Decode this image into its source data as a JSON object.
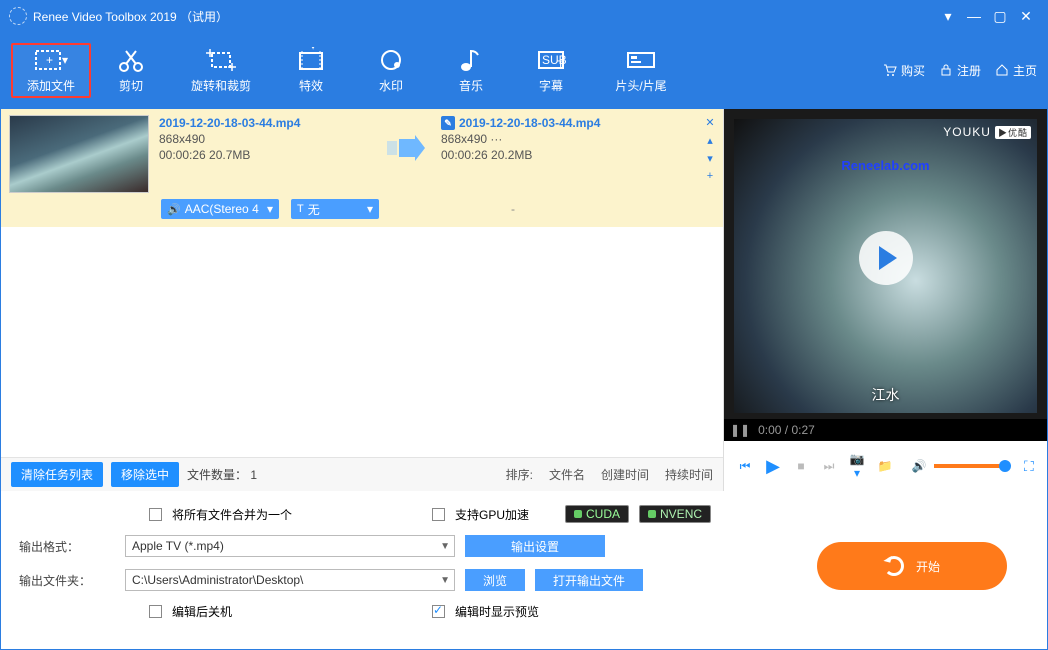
{
  "title": "Renee Video Toolbox 2019 （试用）",
  "toolbar": {
    "add": "添加文件",
    "cut": "剪切",
    "rotate": "旋转和裁剪",
    "effect": "特效",
    "watermark": "水印",
    "music": "音乐",
    "subtitle": "字幕",
    "headtail": "片头/片尾"
  },
  "rightlinks": {
    "buy": "购买",
    "register": "注册",
    "home": "主页"
  },
  "file": {
    "src": {
      "name": "2019-12-20-18-03-44.mp4",
      "res": "868x490",
      "dur_size": "00:00:26  20.7MB"
    },
    "out": {
      "name": "2019-12-20-18-03-44.mp4",
      "res": "868x490    ···",
      "dur_size": "00:00:26  20.2MB"
    },
    "audio_tag": "AAC(Stereo 4",
    "text_tag": "无",
    "dash": "-"
  },
  "listbar": {
    "clear": "清除任务列表",
    "remove": "移除选中",
    "count_lbl": "文件数量：",
    "count_val": "1",
    "sort_lbl": "排序:",
    "sort1": "文件名",
    "sort2": "创建时间",
    "sort3": "持续时间"
  },
  "preview": {
    "youku": "YOUKU",
    "youku_badge": "▶优酷",
    "logo": "Reneelab.com",
    "subtitle": "江水",
    "time": "0:00 / 0:27"
  },
  "options": {
    "merge": "将所有文件合并为一个",
    "gpu": "支持GPU加速",
    "cuda": "CUDA",
    "nvenc": "NVENC",
    "out_fmt_lbl": "输出格式：",
    "out_fmt_val": "Apple TV (*.mp4)",
    "out_set": "输出设置",
    "out_dir_lbl": "输出文件夹：",
    "out_dir_val": "C:\\Users\\Administrator\\Desktop\\",
    "browse": "浏览",
    "open_out": "打开输出文件",
    "shutdown": "编辑后关机",
    "show_preview": "编辑时显示预览"
  },
  "start": "开始"
}
